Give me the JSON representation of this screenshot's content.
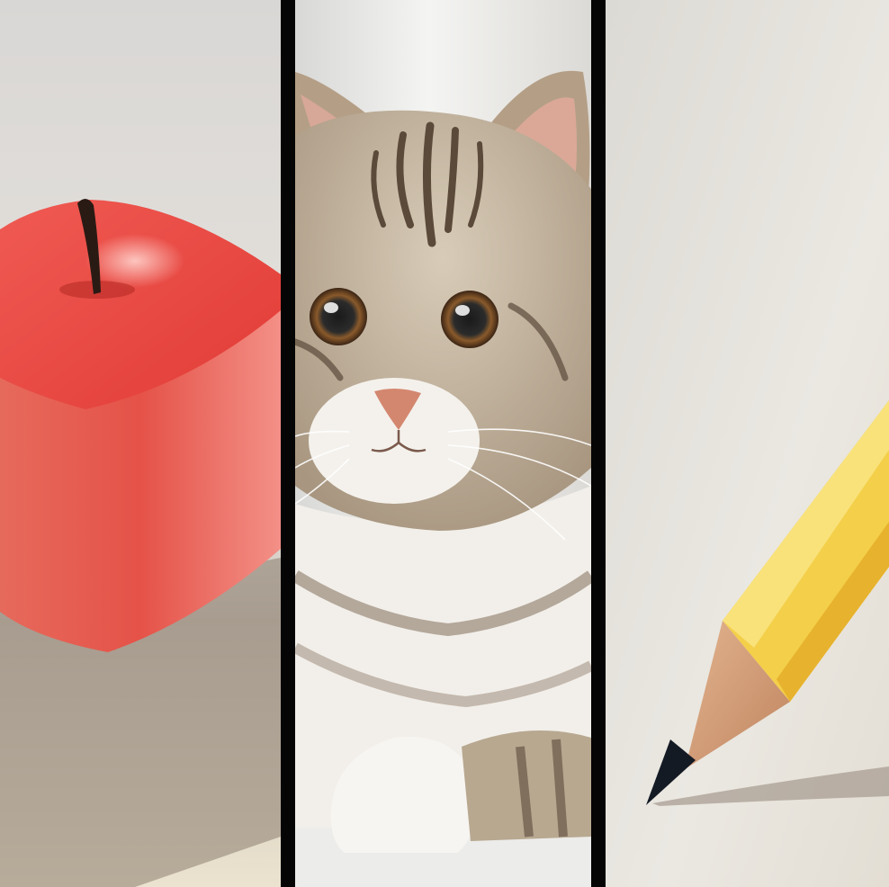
{
  "image": {
    "panels": [
      {
        "subject": "apple",
        "label": ""
      },
      {
        "subject": "cat",
        "label": ""
      },
      {
        "subject": "pencil",
        "label": ""
      }
    ],
    "colors": {
      "apple_red": "#e34a43",
      "cat_fur": "#b8a890",
      "cat_stripe": "#5b4a3a",
      "pencil_yellow": "#f4cf49",
      "divider": "#050505",
      "background": "#e9e6e1"
    }
  }
}
